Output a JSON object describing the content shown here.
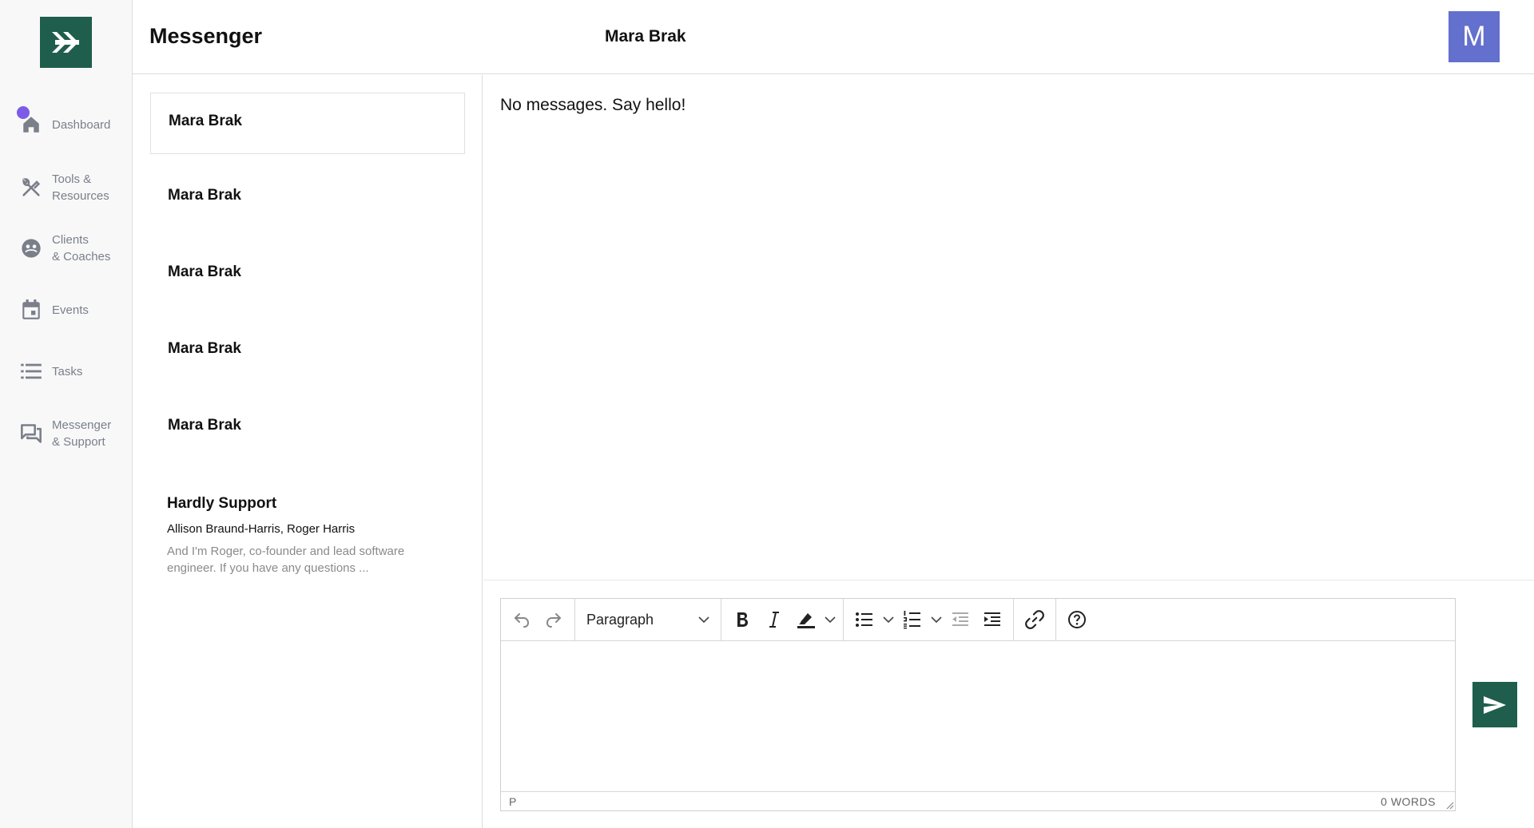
{
  "sidebar": {
    "logo": "logo-icon",
    "items": [
      {
        "label": "Dashboard",
        "icon": "home-icon"
      },
      {
        "label": "Tools &\nResources",
        "icon": "tools-icon"
      },
      {
        "label": "Clients\n& Coaches",
        "icon": "clients-icon"
      },
      {
        "label": "Events",
        "icon": "calendar-icon"
      },
      {
        "label": "Tasks",
        "icon": "list-icon"
      },
      {
        "label": "Messenger\n& Support",
        "icon": "chat-icon"
      }
    ]
  },
  "header": {
    "title": "Messenger",
    "contact_name": "Mara Brak",
    "avatar_initial": "M"
  },
  "conversations": [
    {
      "name": "Mara Brak"
    },
    {
      "name": "Mara Brak"
    },
    {
      "name": "Mara Brak"
    },
    {
      "name": "Mara Brak"
    },
    {
      "name": "Mara Brak"
    },
    {
      "name": "Hardly Support",
      "participants": "Allison Braund-Harris, Roger Harris",
      "preview": "And I'm Roger, co-founder and lead software engineer. If you have any questions ..."
    }
  ],
  "messages": {
    "empty_text": "No messages. Say hello!"
  },
  "editor": {
    "block_format": "Paragraph",
    "status_path": "P",
    "word_count": "0 WORDS"
  },
  "colors": {
    "brand": "#1f5e4c",
    "avatar": "#6370cd",
    "active_dot": "#7b5ce8"
  }
}
